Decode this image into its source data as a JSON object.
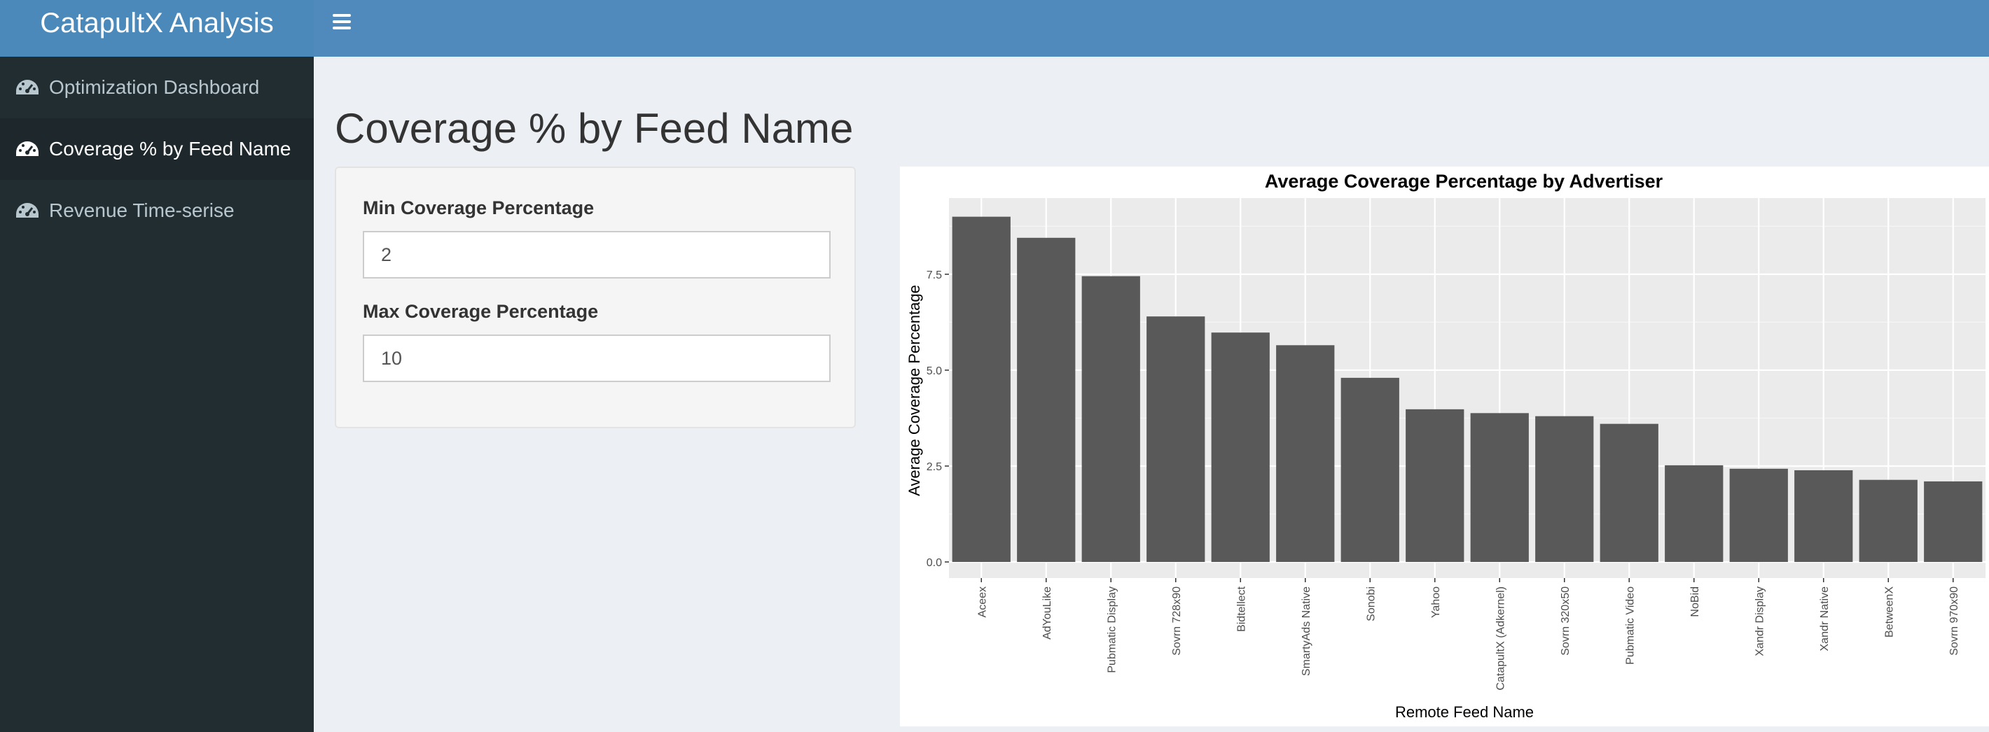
{
  "header": {
    "app_title": "CatapultX Analysis"
  },
  "sidebar": {
    "items": [
      {
        "label": "Optimization Dashboard",
        "icon": "dashboard-icon",
        "active": false
      },
      {
        "label": "Coverage % by Feed Name",
        "icon": "dashboard-icon",
        "active": true
      },
      {
        "label": "Revenue Time-serise",
        "icon": "dashboard-icon",
        "active": false
      }
    ]
  },
  "main": {
    "page_title": "Coverage % by Feed Name",
    "filters": {
      "min_label": "Min Coverage Percentage",
      "min_value": "2",
      "max_label": "Max Coverage Percentage",
      "max_value": "10"
    }
  },
  "colors": {
    "navbar": "#5089bc",
    "sidebar": "#222d32",
    "bar": "#595959",
    "panel_bg": "#ecf0f5"
  },
  "chart_data": {
    "type": "bar",
    "title": "Average Coverage Percentage by Advertiser",
    "xlabel": "Remote Feed Name",
    "ylabel": "Average Coverage Percentage",
    "categories": [
      "Aceex",
      "AdYouLike",
      "Pubmatic Display",
      "Sovrn 728x90",
      "Bidtellect",
      "SmartyAds Native",
      "Sonobi",
      "Yahoo",
      "CatapultX (Adkernel)",
      "Sovrn 320x50",
      "Pubmatic Video",
      "NoBid",
      "Xandr Display",
      "Xandr Native",
      "BetweenX",
      "Sovrn 970x90"
    ],
    "values": [
      9.0,
      8.45,
      7.45,
      6.4,
      5.98,
      5.65,
      4.8,
      3.98,
      3.88,
      3.8,
      3.6,
      2.52,
      2.43,
      2.39,
      2.14,
      2.1
    ],
    "yticks": [
      "0.0",
      "2.5",
      "5.0",
      "7.5"
    ],
    "ylim": [
      0,
      9.45
    ],
    "grid": true
  }
}
